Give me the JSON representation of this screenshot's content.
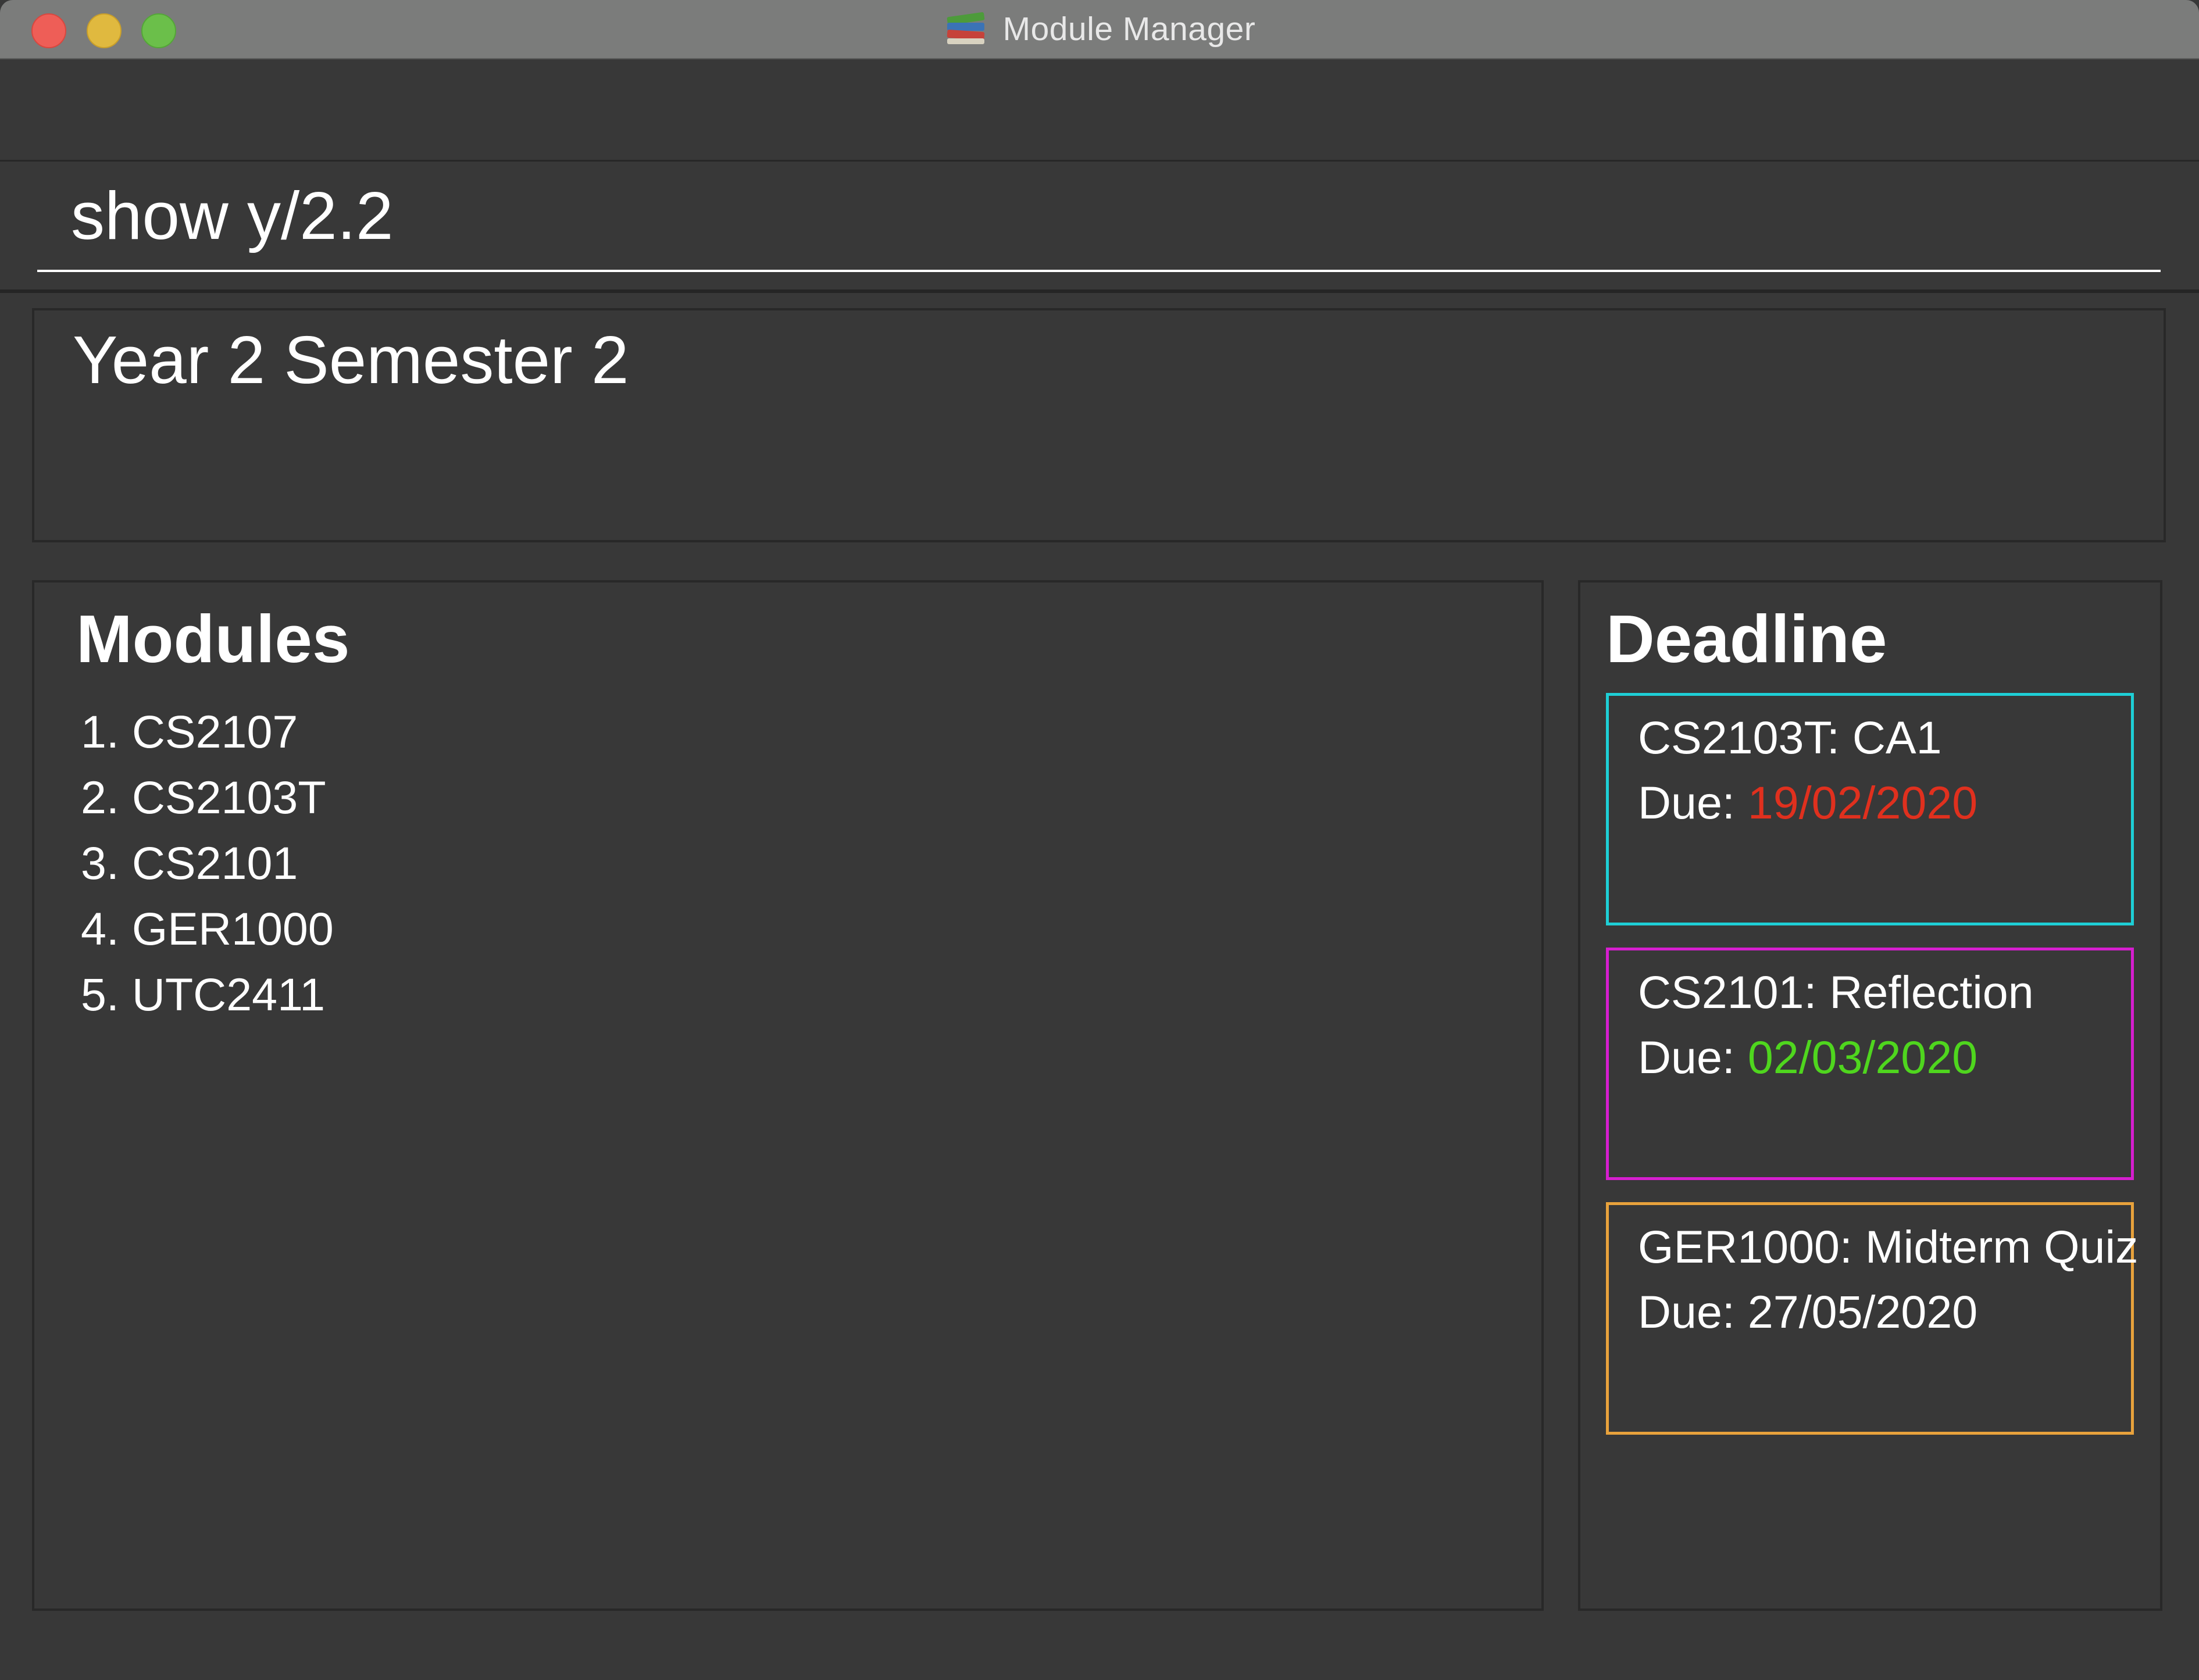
{
  "window": {
    "title": "Module Manager",
    "app_icon": "books-icon"
  },
  "command": {
    "value": "show y/2.2"
  },
  "result": {
    "text": "Year 2 Semester 2"
  },
  "modules": {
    "heading": "Modules",
    "items": [
      {
        "label": "1. CS2107"
      },
      {
        "label": "2. CS2103T"
      },
      {
        "label": "3. CS2101"
      },
      {
        "label": "4. GER1000"
      },
      {
        "label": "5. UTC2411"
      }
    ]
  },
  "deadlines": {
    "heading": "Deadline",
    "items": [
      {
        "title": "CS2103T: CA1",
        "due_label": "Due: ",
        "due_date": "19/02/2020",
        "border_color": "#1ecfd6",
        "date_color": "#e0301e"
      },
      {
        "title": "CS2101: Reflection",
        "due_label": "Due: ",
        "due_date": "02/03/2020",
        "border_color": "#d61ecf",
        "date_color": "#4fd61e"
      },
      {
        "title": "GER1000: Midterm Quiz",
        "due_label": "Due: ",
        "due_date": "27/05/2020",
        "border_color": "#e8a23c",
        "date_color": "#ffffff"
      }
    ]
  },
  "colors": {
    "background": "#383838",
    "titlebar": "#7b7c7b",
    "text": "#ffffff"
  }
}
